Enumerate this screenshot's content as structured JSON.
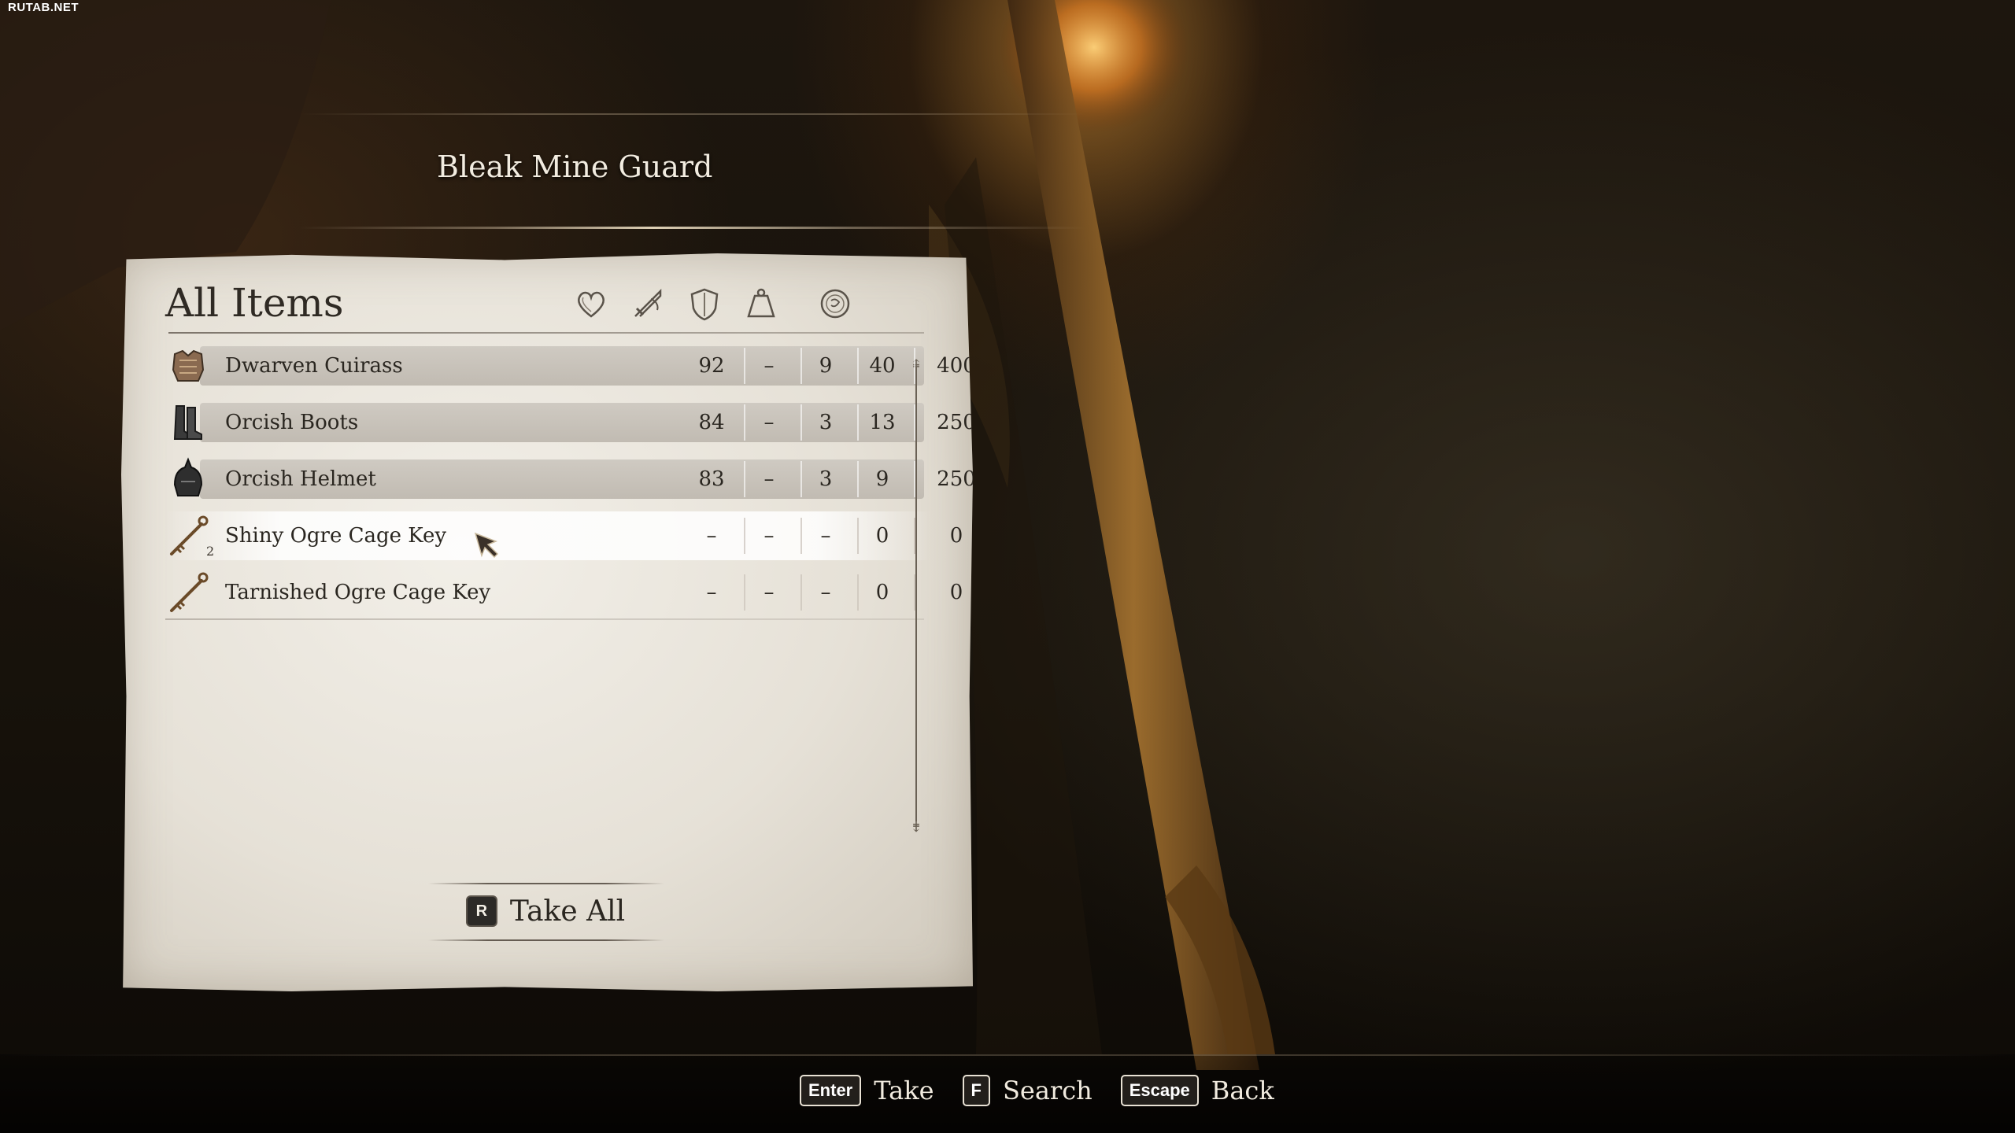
{
  "watermark": "RUTAB.NET",
  "container": {
    "title": "Bleak Mine Guard"
  },
  "panel": {
    "title": "All Items",
    "columns": [
      {
        "icon": "heart-health-icon"
      },
      {
        "icon": "crossed-swords-damage-icon"
      },
      {
        "icon": "shield-armor-icon"
      },
      {
        "icon": "weight-icon"
      },
      {
        "icon": "coin-value-icon"
      }
    ],
    "items": [
      {
        "name": "Dwarven Cuirass",
        "icon": "cuirass-icon",
        "count": "",
        "values": [
          "92",
          "–",
          "9",
          "40",
          "400"
        ]
      },
      {
        "name": "Orcish Boots",
        "icon": "boots-icon",
        "count": "",
        "values": [
          "84",
          "–",
          "3",
          "13",
          "250"
        ]
      },
      {
        "name": "Orcish Helmet",
        "icon": "helmet-icon",
        "count": "",
        "values": [
          "83",
          "–",
          "3",
          "9",
          "250"
        ]
      },
      {
        "name": "Shiny Ogre Cage Key",
        "icon": "key-icon",
        "count": "2",
        "values": [
          "–",
          "–",
          "–",
          "0",
          "0"
        ]
      },
      {
        "name": "Tarnished Ogre Cage Key",
        "icon": "key-icon",
        "count": "",
        "values": [
          "–",
          "–",
          "–",
          "0",
          "0"
        ]
      }
    ],
    "take_all": {
      "key": "R",
      "label": "Take All"
    }
  },
  "hints": [
    {
      "key": "Enter",
      "label": "Take"
    },
    {
      "key": "F",
      "label": "Search"
    },
    {
      "key": "Escape",
      "label": "Back"
    }
  ]
}
